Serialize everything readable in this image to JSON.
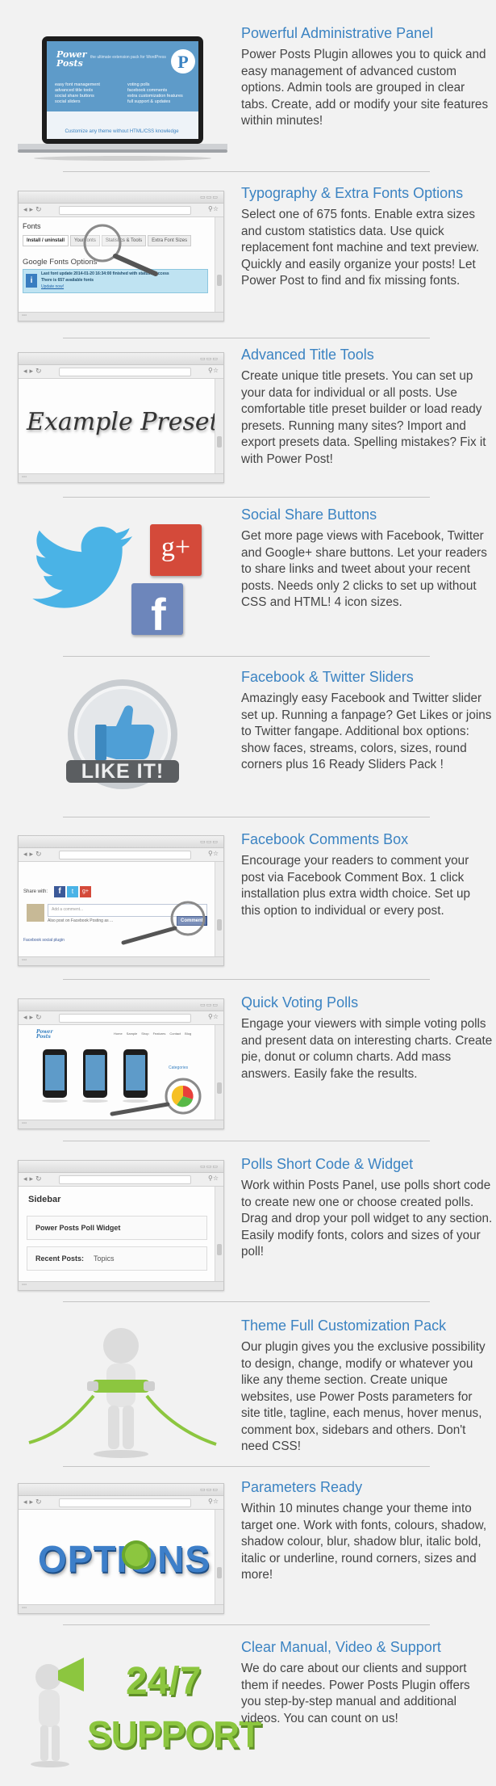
{
  "features": [
    {
      "title": "Powerful Administrative Panel",
      "description": "Power Posts Plugin allowes you to quick and easy management of advanced custom options. Admin tools are grouped in clear tabs. Create, add or modify your site features within minutes!",
      "thumb": {
        "logo": "Power Posts",
        "tagline": "the ultimate extension pack for WordPress",
        "left_list": [
          "easy font management",
          "advanced title tools",
          "social share buttons",
          "social sliders"
        ],
        "right_list": [
          "voting polls",
          "facebook comments",
          "extra customization features",
          "full support & updates"
        ],
        "footer": "Customize any theme without HTML/CSS knowledge"
      }
    },
    {
      "title": "Typography & Extra Fonts Options",
      "description": "Select one of 675 fonts. Enable extra sizes and custom statistics data. Use quick replacement font machine and text preview. Quickly and easily organize your posts! Let Power Post to find and fix missing fonts.",
      "thumb": {
        "heading": "Fonts",
        "tabs": [
          "Install / uninstall",
          "Your fonts",
          "Statistics & Tools",
          "Extra Font Sizes"
        ],
        "subheading": "Google Fonts Options",
        "notice_line1": "Last font update  2014-01-20 16:34:00 finished with status: Success",
        "notice_line2": "There is 657 available fonts",
        "notice_link": "Update now!"
      }
    },
    {
      "title": "Advanced Title Tools",
      "description": "Create unique title presets. You can set up your data for individual or all posts. Use comfortable title preset builder or load ready presets. Running many sites? Import and export presets data. Spelling mistakes? Fix it with Power Post!",
      "thumb": {
        "preset_text": "Example Preset"
      }
    },
    {
      "title": "Social Share Buttons",
      "description": "Get more page views with Facebook, Twitter and Google+ share buttons. Let your readers to share links and tweet about your recent posts. Needs only 2 clicks to set up without CSS and HTML! 4 icon sizes.",
      "thumb": {
        "gplus_text": "g+",
        "facebook_text": "f"
      }
    },
    {
      "title": "Facebook & Twitter Sliders",
      "description": "Amazingly easy Facebook and Twitter slider set up. Running a fanpage? Get Likes or joins to Twitter fangape. Additional box options: show faces, streams, colors, sizes, round corners plus 16 Ready Sliders Pack !",
      "thumb": {
        "badge_text": "LIKE IT!"
      }
    },
    {
      "title": "Facebook Comments Box",
      "description": "Encourage your readers to comment your post via Facebook Comment Box. 1 click installation plus extra width choice. Set up this option to individual or every post.",
      "thumb": {
        "share_label": "Share with:",
        "comment_placeholder": "Add a comment...",
        "also_post": "Also post on Facebook   Posting as ...",
        "comment_button": "Comment",
        "plugin_label": "Facebook social plugin"
      }
    },
    {
      "title": "Quick Voting Polls",
      "description": "Engage your viewers with simple voting polls and present data on interesting charts. Create pie, donut or column charts. Add mass answers. Easily fake the results.",
      "thumb": {
        "logo": "Power Posts",
        "menu": [
          "Home",
          "Sample",
          "Shop",
          "Features",
          "Contact",
          "Blog"
        ],
        "sidebar_heading": "Categories"
      }
    },
    {
      "title": "Polls Short Code & Widget",
      "description": "Work within Posts Panel, use polls short code to create new one or choose created polls. Drag and drop your poll widget to any section. Easily modify fonts, colors and sizes of your poll!",
      "thumb": {
        "sidebar_title": "Sidebar",
        "widget_1": "Power Posts Poll Widget",
        "widget_2_label": "Recent Posts:",
        "widget_2_value": "Topics"
      }
    },
    {
      "title": "Theme Full Customization Pack",
      "description": "Our plugin gives you the exclusive possibility to design, change, modify or whatever you like any theme section. Create unique websites, use Power Posts parameters for site title, tagline, each menus, hover menus, comment box, sidebars and others. Don't need CSS!",
      "thumb": {}
    },
    {
      "title": "Parameters Ready",
      "description": "Within 10 minutes change your theme into target one. Work with fonts, colours, shadow, shadow colour, blur, shadow blur, italic bold, italic or underline, round corners, sizes and more!",
      "thumb": {
        "options_text": "OPTIONS"
      }
    },
    {
      "title": "Clear Manual, Video & Support",
      "description": "We do care about our clients and support them if needes. Power Posts Plugin offers you step-by-step manual and additional videos. You can count on us!",
      "thumb": {
        "big_text": "24/7",
        "support_text": "SUPPORT"
      }
    }
  ],
  "colors": {
    "title_blue": "#3b83c2",
    "body_text": "#444444",
    "twitter": "#4ab3e6",
    "gplus": "#d44a3a",
    "facebook": "#6d86bb",
    "green": "#8cc63f",
    "options_blue": "#3d7fc9"
  }
}
